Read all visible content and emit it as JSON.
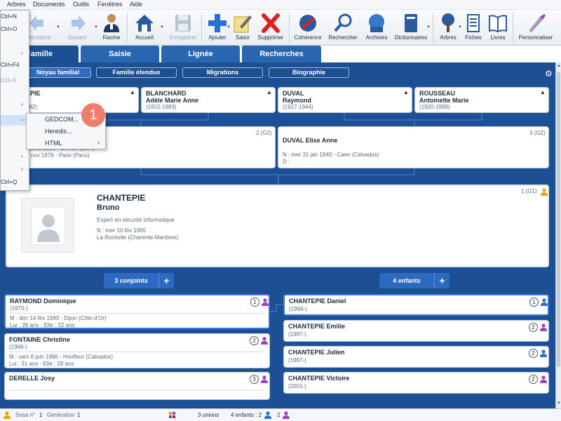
{
  "menubar": {
    "items": [
      "Arbres",
      "Documents",
      "Outils",
      "Fenêtres",
      "Aide"
    ]
  },
  "toolbar": {
    "buttons": [
      {
        "label": "Précédent",
        "icon": "back-arrow-icon"
      },
      {
        "label": "Suivant",
        "icon": "forward-arrow-icon"
      },
      {
        "label": "Racine",
        "icon": "root-person-icon"
      },
      {
        "label": "Accueil",
        "icon": "home-icon"
      },
      {
        "label": "Enregistrer",
        "icon": "save-icon"
      },
      {
        "label": "Ajouter",
        "icon": "add-icon"
      },
      {
        "label": "Saisir",
        "icon": "edit-icon"
      },
      {
        "label": "Supprimer",
        "icon": "delete-icon"
      },
      {
        "label": "Cohérence",
        "icon": "coherence-icon"
      },
      {
        "label": "Rechercher",
        "icon": "search-icon"
      },
      {
        "label": "Archives",
        "icon": "archives-icon"
      },
      {
        "label": "Dictionnaires",
        "icon": "dictionaries-icon"
      },
      {
        "label": "Arbres",
        "icon": "tree-icon"
      },
      {
        "label": "Fiches",
        "icon": "records-icon"
      },
      {
        "label": "Livres",
        "icon": "books-icon"
      },
      {
        "label": "Personnaliser",
        "icon": "customize-icon"
      }
    ]
  },
  "tabs": [
    "Famille",
    "Saisie",
    "Lignée",
    "Recherches"
  ],
  "subtabs": [
    "Noyau familial",
    "Famille étendue",
    "Migrations",
    "Biographie"
  ],
  "grandparents": [
    {
      "surname": "EPIE",
      "given": "",
      "dates": "982)"
    },
    {
      "surname": "BLANCHARD",
      "given": "Adèle Marie Anne",
      "dates": "(1915-1993)"
    },
    {
      "surname": "DUVAL",
      "given": "Raymond",
      "dates": "(1917-1944)"
    },
    {
      "surname": "ROUSSEAU",
      "given": "Antoinette Marie",
      "dates": "(1920-1999)"
    }
  ],
  "parents": [
    {
      "label": "2 (G2)",
      "lines": [
        "4 août 1936 - Évreux (Eure)",
        "8 nov 1976 - Paris (Paris)"
      ]
    },
    {
      "label": "3 (G2)",
      "name": "DUVAL Elise Anne",
      "lines": [
        "N : mer 31 jan 1940 - Caen (Calvados)",
        "D :"
      ]
    }
  ],
  "main_person": {
    "label": "1 (G1)",
    "surname": "CHANTEPIE",
    "given": "Bruno",
    "occupation": "Expert en sécurité informatique",
    "birth": "N : mer 10 fév 1965",
    "place": "La Rochelle (Charente-Maritime)"
  },
  "spouses_button": "3 conjoints",
  "children_button": "4 enfants",
  "spouses": [
    {
      "name": "RAYMOND Dominique",
      "dates": "(1970-)",
      "num": "1",
      "marriage": "M : dim 14 fév 1993 - Dijon (Côte-d'Or)",
      "ages": "Lui : 28 ans - Elle : 22 ans"
    },
    {
      "name": "FONTAINE Christine",
      "dates": "(1966-)",
      "num": "2",
      "marriage": "M : sam 8 juin 1996 - Honfleur (Calvados)",
      "ages": "Lui : 31 ans - Elle : 29 ans"
    },
    {
      "name": "DERELLE Josy",
      "dates": "",
      "num": "3",
      "marriage": "",
      "ages": ""
    }
  ],
  "children": [
    {
      "name": "CHANTEPIE Daniel",
      "dates": "(1994-)",
      "num": "1"
    },
    {
      "name": "CHANTEPIE Emilie",
      "dates": "(1997-)",
      "num": "2"
    },
    {
      "name": "CHANTEPIE Julien",
      "dates": "(1997-)",
      "num": "2"
    },
    {
      "name": "CHANTEPIE Victoire",
      "dates": "(2001-)",
      "num": "2"
    }
  ],
  "statusbar": {
    "sosa_label": "Sosa n°",
    "sosa_value": "1",
    "gen_label": "Génération",
    "gen_value": "1",
    "unions": "3 unions",
    "children_label": "4 enfants : 2",
    "children_f": "2"
  },
  "file_menu": {
    "items": [
      {
        "text": "Ctrl+N"
      },
      {
        "text": "Ctrl+O"
      },
      {
        "text": "Ctrl+F4"
      },
      {
        "text": "Ctrl+S"
      },
      {
        "text": "Ctrl+Q"
      }
    ]
  },
  "export_submenu": {
    "items": [
      "GEDCOM...",
      "Heredis...",
      "HTML"
    ]
  },
  "callout": "1",
  "colors": {
    "panel": "#1c4f93",
    "tab": "#2a66b0",
    "accent": "#3d7bd6",
    "male": "#2a6fd6",
    "female": "#9b3fc4"
  }
}
